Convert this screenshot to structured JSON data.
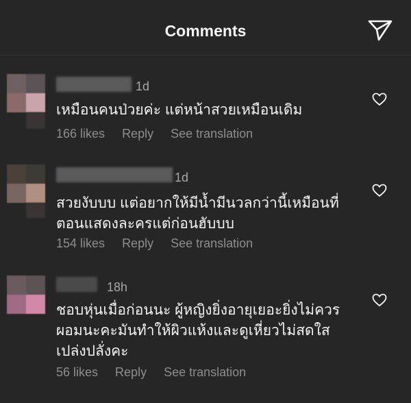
{
  "header": {
    "title": "Comments"
  },
  "comments": [
    {
      "time": "1d",
      "text_lines": [
        "เหมือนคนป่วยค่ะ แต่หน้าสวยเหมือนเดิม"
      ],
      "likes": "166 likes",
      "reply": "Reply",
      "translate": "See translation"
    },
    {
      "time": "1d",
      "text_lines": [
        "สวยงับบบ แต่อยากให้มีน้ำมีนวลกว่านี้เหมือนที่",
        "ตอนแสดงละครแต่ก่อนฮับบบ"
      ],
      "likes": "154 likes",
      "reply": "Reply",
      "translate": "See translation"
    },
    {
      "time": "18h",
      "text_lines": [
        "ชอบหุ่นเมื่อก่อนนะ ผู้หญิงยิ่งอายุเยอะยิ่งไม่ควร",
        "ผอมนะคะมันทำให้ผิวแห้งและดูเหี่ยวไม่สดใส",
        "เปล่งปลั่งคะ"
      ],
      "likes": "56 likes",
      "reply": "Reply",
      "translate": "See translation"
    }
  ],
  "icons": {
    "share": "paper-plane-icon",
    "like": "heart-outline-icon"
  },
  "colors": {
    "background": "#262626",
    "text": "#f5f5f5",
    "muted": "#8e8e8e"
  }
}
